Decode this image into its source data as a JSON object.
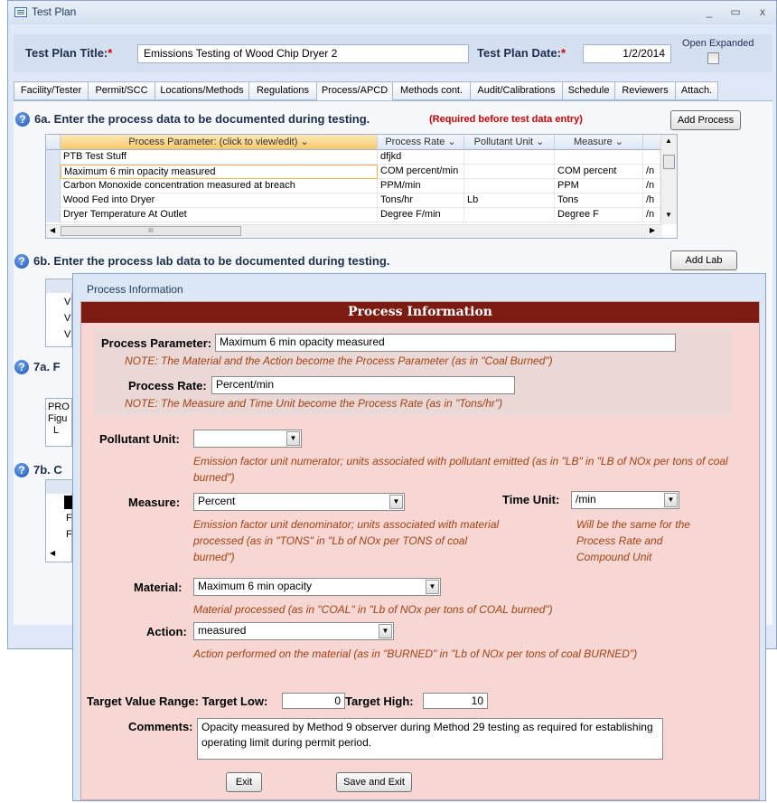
{
  "window": {
    "title": "Test Plan",
    "minimize": "_",
    "maximize": "▭",
    "close": "x"
  },
  "header": {
    "title_label": "Test Plan Title:",
    "title_required": "*",
    "title_value": "Emissions Testing of Wood Chip Dryer 2",
    "date_label": "Test Plan Date:",
    "date_required": "*",
    "date_value": "1/2/2014",
    "open_expanded_label": "Open Expanded"
  },
  "tabs": [
    "Facility/Tester",
    "Permit/SCC",
    "Locations/Methods",
    "Regulations",
    "Process/APCD",
    "Methods cont.",
    "Audit/Calibrations",
    "Schedule",
    "Reviewers",
    "Attach."
  ],
  "section_6a": {
    "title": "6a.  Enter the process data to be documented during testing.",
    "required_note": "(Required before test data entry)",
    "add_button": "Add Process"
  },
  "process_grid": {
    "columns": [
      "Process Parameter: (click to view/edit)",
      "Process Rate",
      "Pollutant Unit",
      "Measure"
    ],
    "rows": [
      [
        "PTB Test Stuff",
        "dfjkd",
        "",
        "",
        ""
      ],
      [
        "Maximum 6 min opacity measured",
        "COM percent/min",
        "",
        "COM percent",
        "/n"
      ],
      [
        "Carbon Monoxide concentration measured at breach",
        "PPM/min",
        "",
        "PPM",
        "/n"
      ],
      [
        "Wood Fed into Dryer",
        "Tons/hr",
        "Lb",
        "Tons",
        "/h"
      ],
      [
        "Dryer Temperature At Outlet",
        "Degree F/min",
        "",
        "Degree F",
        "/n"
      ]
    ],
    "hscroll_grip": "III"
  },
  "section_6b": {
    "title": "6b.  Enter the process lab data to be documented during testing.",
    "add_button": "Add Lab"
  },
  "hidden_fragments": {
    "s7a": "7a.  F",
    "s7b": "7b.  C",
    "pro_lines": [
      "PRO",
      "Figu",
      "L"
    ],
    "grid2_lines": [
      "V",
      "V",
      "V"
    ],
    "grid3_lines": [
      "F",
      "F"
    ]
  },
  "dialog": {
    "window_title": "Process Information",
    "banner": "Process Information",
    "process_parameter_label": "Process Parameter:",
    "process_parameter_value": "Maximum 6 min opacity measured",
    "process_parameter_note": "NOTE: The Material and the Action become the Process Parameter (as in \"Coal Burned\")",
    "process_rate_label": "Process Rate:",
    "process_rate_value": "Percent/min",
    "process_rate_note": "NOTE: The Measure and Time Unit become the Process Rate (as in \"Tons/hr\")",
    "pollutant_unit_label": "Pollutant Unit:",
    "pollutant_unit_value": "",
    "pollutant_unit_note": "Emission factor unit numerator; units associated with pollutant emitted (as in \"LB\" in \"LB of NOx per tons of coal burned\")",
    "measure_label": "Measure:",
    "measure_value": "Percent",
    "measure_note": "Emission factor unit denominator; units associated with material processed (as in \"TONS\" in \"Lb of NOx per TONS of coal burned\")",
    "time_unit_label": "Time Unit:",
    "time_unit_value": "/min",
    "time_unit_note": "Will be the same for the Process Rate and Compound Unit",
    "material_label": "Material:",
    "material_value": "Maximum 6 min opacity",
    "material_note": "Material processed (as in \"COAL\" in \"Lb of NOx per tons of COAL burned\")",
    "action_label": "Action:",
    "action_value": "measured",
    "action_note": "Action performed on the material (as in \"BURNED\" in \"Lb of NOx per tons of coal BURNED\")",
    "target_range_label": "Target Value Range: Target Low:",
    "target_low": "0",
    "target_high_label": "Target High:",
    "target_high": "10",
    "comments_label": "Comments:",
    "comments_value": "Opacity measured by Method 9 observer during Method 29 testing as required for establishing operating limit during permit period.",
    "exit_button": "Exit",
    "save_exit_button": "Save and Exit"
  },
  "icons": {
    "help": "?",
    "dropdown": "▼",
    "scroll_up": "▲",
    "scroll_down": "▼",
    "scroll_left": "◀",
    "scroll_right": "▶"
  },
  "colors": {
    "banner": "#7b1b12",
    "note": "#a34112",
    "required": "#d00000",
    "dialog_body": "#f6d7d3"
  }
}
